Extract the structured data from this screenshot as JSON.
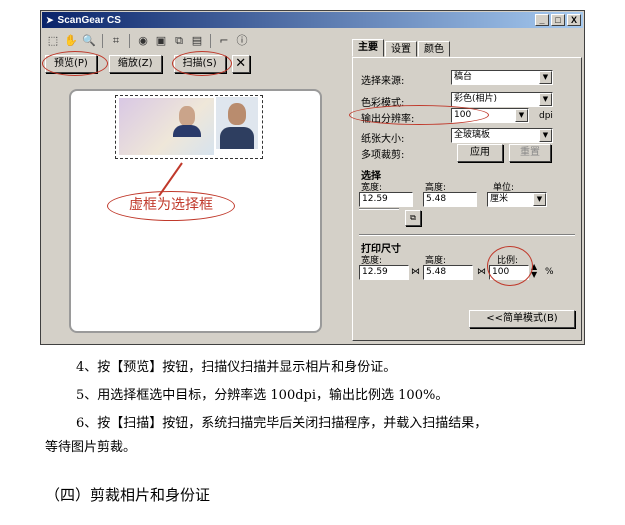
{
  "window": {
    "title": "ScanGear CS",
    "controls": [
      "_",
      "□",
      "X"
    ]
  },
  "preview": {
    "buttons": {
      "preview": "预览(P)",
      "zoom": "缩放(Z)",
      "scan": "扫描(S)",
      "close": "✕"
    },
    "callout": "虚框为选择框"
  },
  "panel": {
    "tabs": [
      "主要",
      "设置",
      "颜色"
    ],
    "source_label": "选择来源:",
    "source_value": "稿台",
    "color_mode_label": "色彩模式:",
    "color_mode_value": "彩色(相片)",
    "resolution_label": "输出分辨率:",
    "resolution_value": "100",
    "resolution_unit": "dpi",
    "paper_size_label": "纸张大小:",
    "paper_size_value": "全玻璃板",
    "multi_crop_label": "多项裁剪:",
    "apply_button": "应用",
    "reset_button": "重置",
    "select_header": "选择",
    "width_label": "宽度:",
    "height_label": "高度:",
    "unit_label": "单位:",
    "select_width": "12.59",
    "select_height": "5.48",
    "unit_value": "厘米",
    "print_header": "打印尺寸",
    "print_width_label": "宽度:",
    "print_height_label": "高度:",
    "scale_label": "比例:",
    "print_width": "12.59",
    "print_height": "5.48",
    "scale_value": "100",
    "percent": "%",
    "simple_mode_button": "<<简单模式(B)"
  },
  "text": {
    "step4": "4、按【预览】按钮，扫描仪扫描并显示相片和身份证。",
    "step5": "5、用选择框选中目标，分辨率选 100dpi，输出比例选 100%。",
    "step6a": "6、按【扫描】按钮，系统扫描完毕后关闭扫描程序，并载入扫描结果，",
    "step6b": "等待图片剪裁。",
    "section": "（四）剪裁相片和身份证"
  }
}
